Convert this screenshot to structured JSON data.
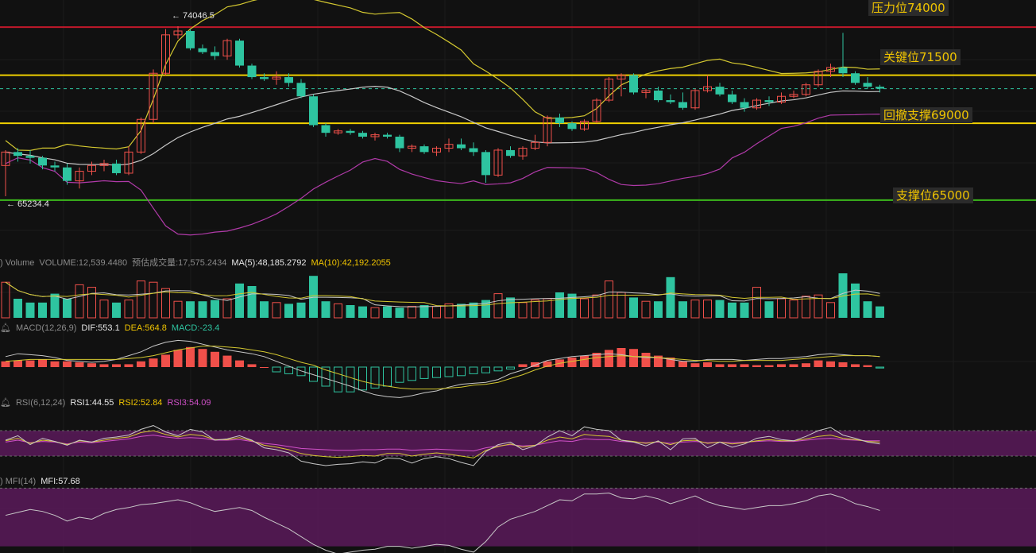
{
  "levels": [
    {
      "label": "压力位74000",
      "value": 74000,
      "color": "#c0182a"
    },
    {
      "label": "关键位71500",
      "value": 71500,
      "color": "#f0d000"
    },
    {
      "label": "回撤支撑69000",
      "value": 69000,
      "color": "#f0d000"
    },
    {
      "label": "支撑位65000",
      "value": 65000,
      "color": "#3cb81c"
    }
  ],
  "extremes": {
    "high": "← 74046.5",
    "low": "← 65234.4"
  },
  "volume_header": {
    "name": ") Volume",
    "volume": "VOLUME:12,539.4480",
    "predicted": "预估成交量:17,575.2434",
    "ma5": "MA(5):48,185.2792",
    "ma10": "MA(10):42,192.2055"
  },
  "macd_header": {
    "name": "MACD(12,26,9)",
    "dif": "DIF:553.1",
    "dea": "DEA:564.8",
    "macd": "MACD:-23.4"
  },
  "rsi_header": {
    "name": "RSI(6,12,24)",
    "rsi1": "RSI1:44.55",
    "rsi2": "RSI2:52.84",
    "rsi3": "RSI3:54.09"
  },
  "mfi_header": {
    "name": ") MFI(14)",
    "mfi": "MFI:57.68"
  },
  "colors": {
    "up": "#f0504a",
    "down": "#2ec4a0",
    "mid": "#c8c8c8",
    "boll_up": "#d4c830",
    "boll_low": "#b03aa8",
    "dif": "#c8c8c8",
    "dea": "#d4c830",
    "rsi_band": "#5a1a5a"
  },
  "chart_data": {
    "type": "candlestick",
    "y_range": [
      64000,
      75000
    ],
    "candles": [
      [
        66800,
        67600,
        65200,
        67500
      ],
      [
        67500,
        67700,
        67000,
        67300
      ],
      [
        67300,
        67600,
        66900,
        67200
      ],
      [
        67200,
        67300,
        66600,
        66800
      ],
      [
        66800,
        67000,
        66500,
        66700
      ],
      [
        66700,
        66900,
        65800,
        66000
      ],
      [
        66000,
        66700,
        65600,
        66500
      ],
      [
        66500,
        67000,
        66300,
        66800
      ],
      [
        66800,
        67100,
        66500,
        66900
      ],
      [
        66900,
        67100,
        66300,
        66400
      ],
      [
        66400,
        67800,
        66300,
        67500
      ],
      [
        67500,
        69300,
        67400,
        69200
      ],
      [
        69200,
        71800,
        69000,
        71600
      ],
      [
        71600,
        73900,
        71500,
        73600
      ],
      [
        73600,
        74046.5,
        73400,
        73800
      ],
      [
        73800,
        73900,
        72800,
        72900
      ],
      [
        72900,
        73100,
        72600,
        72700
      ],
      [
        72700,
        73000,
        72300,
        72500
      ],
      [
        72500,
        73400,
        72300,
        73300
      ],
      [
        73300,
        73400,
        71900,
        72000
      ],
      [
        72000,
        72100,
        71300,
        71400
      ],
      [
        71400,
        71600,
        71200,
        71300
      ],
      [
        71300,
        71700,
        71000,
        71400
      ],
      [
        71400,
        71600,
        70900,
        71100
      ],
      [
        71100,
        71300,
        70300,
        70400
      ],
      [
        70400,
        70500,
        68800,
        68900
      ],
      [
        68900,
        69000,
        68300,
        68500
      ],
      [
        68500,
        68700,
        68400,
        68600
      ],
      [
        68600,
        68700,
        68400,
        68500
      ],
      [
        68500,
        68600,
        68200,
        68300
      ],
      [
        68300,
        68500,
        68100,
        68400
      ],
      [
        68400,
        68500,
        68200,
        68300
      ],
      [
        68300,
        68400,
        67500,
        67700
      ],
      [
        67700,
        67900,
        67500,
        67800
      ],
      [
        67800,
        67900,
        67400,
        67500
      ],
      [
        67500,
        67800,
        67300,
        67700
      ],
      [
        67700,
        68200,
        67500,
        67900
      ],
      [
        67900,
        68200,
        67600,
        67700
      ],
      [
        67700,
        68000,
        67300,
        67500
      ],
      [
        67500,
        67600,
        65900,
        66300
      ],
      [
        66300,
        67700,
        66200,
        67600
      ],
      [
        67600,
        67800,
        67200,
        67300
      ],
      [
        67300,
        67800,
        67100,
        67700
      ],
      [
        67700,
        68400,
        67600,
        68000
      ],
      [
        68000,
        69400,
        67800,
        69300
      ],
      [
        69300,
        69500,
        68800,
        69000
      ],
      [
        69000,
        69100,
        68600,
        68700
      ],
      [
        68700,
        69200,
        68600,
        69100
      ],
      [
        69100,
        70300,
        69000,
        70200
      ],
      [
        70200,
        71400,
        70100,
        71300
      ],
      [
        71300,
        71600,
        70400,
        71500
      ],
      [
        71500,
        71600,
        70500,
        70600
      ],
      [
        70600,
        70800,
        70300,
        70700
      ],
      [
        70700,
        70900,
        70100,
        70200
      ],
      [
        70200,
        70500,
        70000,
        70100
      ],
      [
        70100,
        70600,
        69700,
        69800
      ],
      [
        69800,
        70800,
        69700,
        70700
      ],
      [
        70700,
        71500,
        70600,
        70900
      ],
      [
        70900,
        71100,
        70400,
        70500
      ],
      [
        70500,
        70700,
        70000,
        70100
      ],
      [
        70100,
        70300,
        69600,
        69800
      ],
      [
        69800,
        70300,
        69700,
        70200
      ],
      [
        70200,
        70400,
        69900,
        70100
      ],
      [
        70100,
        70600,
        70000,
        70400
      ],
      [
        70400,
        70700,
        70300,
        70500
      ],
      [
        70500,
        71100,
        70400,
        71000
      ],
      [
        71000,
        71800,
        70900,
        71700
      ],
      [
        71700,
        72100,
        71400,
        71900
      ],
      [
        71900,
        73700,
        71400,
        71600
      ],
      [
        71600,
        71700,
        71000,
        71100
      ],
      [
        71100,
        71400,
        70800,
        70900
      ],
      [
        70900,
        71000,
        70600,
        70800
      ]
    ],
    "volume": [
      2.8,
      1.5,
      1.2,
      1.2,
      1.9,
      1.5,
      2.6,
      2.4,
      1.4,
      1.2,
      1.4,
      2.9,
      2.8,
      2.3,
      1.3,
      1.3,
      1.3,
      1.4,
      1.5,
      2.7,
      2.5,
      1.3,
      1.2,
      1.1,
      1.2,
      3.3,
      1.3,
      1.1,
      1.0,
      0.9,
      0.8,
      0.9,
      0.8,
      0.9,
      1.0,
      0.9,
      1.1,
      1.1,
      1.2,
      1.4,
      1.9,
      1.6,
      1.2,
      1.4,
      1.5,
      2.0,
      1.9,
      1.5,
      1.8,
      2.9,
      2.0,
      1.6,
      1.3,
      1.3,
      3.2,
      1.3,
      1.4,
      1.4,
      1.4,
      1.2,
      1.2,
      2.4,
      1.3,
      1.5,
      1.4,
      1.7,
      1.8,
      1.2,
      3.5,
      2.7,
      1.3,
      0.9
    ],
    "macd": [
      0.6,
      0.7,
      0.7,
      0.8,
      0.6,
      0.6,
      0.5,
      0.4,
      0.3,
      0.3,
      0.3,
      0.6,
      0.9,
      1.3,
      1.8,
      2.1,
      1.9,
      1.6,
      1.2,
      0.7,
      0.3,
      0,
      -0.5,
      -0.7,
      -0.9,
      -1.5,
      -2.0,
      -2.6,
      -2.6,
      -2.4,
      -2.2,
      -2.0,
      -1.6,
      -1.4,
      -1.2,
      -1.1,
      -1.0,
      -0.9,
      -0.7,
      -0.6,
      -0.4,
      -0.2,
      0.3,
      0.5,
      0.6,
      0.8,
      1.0,
      1.2,
      1.5,
      1.8,
      2.0,
      1.9,
      1.5,
      1.2,
      1.0,
      0.6,
      0.4,
      0.5,
      0.3,
      0.3,
      0.3,
      0.2,
      0.2,
      0.3,
      0.3,
      0.4,
      0.7,
      0.6,
      0.5,
      0.3,
      0.2,
      -0.1
    ],
    "dif": [
      1.1,
      1.4,
      1.3,
      1.2,
      1.0,
      0.7,
      0.6,
      0.5,
      0.6,
      0.8,
      1.2,
      1.6,
      2.2,
      2.6,
      2.8,
      2.7,
      2.4,
      2.1,
      1.8,
      1.6,
      1.4,
      1.1,
      0.6,
      0.1,
      -0.4,
      -0.8,
      -1.2,
      -1.6,
      -2.0,
      -2.5,
      -2.9,
      -3.1,
      -3.2,
      -3.0,
      -2.7,
      -2.5,
      -2.1,
      -1.8,
      -1.7,
      -1.6,
      -1.3,
      -0.7,
      -0.3,
      0.2,
      0.7,
      0.9,
      1.1,
      1.2,
      1.3,
      1.4,
      1.3,
      1.1,
      1.0,
      1.0,
      0.8,
      0.6,
      0.6,
      0.8,
      0.8,
      0.8,
      0.7,
      0.8,
      0.9,
      0.9,
      1.0,
      1.1,
      1.3,
      1.4,
      1.3,
      1.2,
      1.2,
      1.1
    ],
    "dea": [
      0.6,
      0.7,
      0.8,
      0.8,
      0.8,
      0.8,
      0.8,
      0.8,
      0.8,
      0.8,
      0.9,
      1.0,
      1.2,
      1.5,
      1.8,
      2.0,
      2.2,
      2.2,
      2.1,
      2.0,
      1.8,
      1.6,
      1.3,
      0.9,
      0.5,
      0.2,
      -0.3,
      -0.7,
      -1.1,
      -1.5,
      -1.8,
      -2.0,
      -2.2,
      -2.3,
      -2.3,
      -2.3,
      -2.2,
      -2.1,
      -1.9,
      -1.8,
      -1.6,
      -1.2,
      -0.8,
      -0.3,
      0.1,
      0.4,
      0.6,
      0.8,
      1.0,
      1.1,
      1.2,
      1.1,
      1.1,
      1.0,
      0.9,
      0.8,
      0.7,
      0.7,
      0.6,
      0.6,
      0.7,
      0.7,
      0.7,
      0.7,
      0.8,
      0.9,
      1.0,
      1.1,
      1.2,
      1.2,
      1.2,
      1.1
    ],
    "rsi1": [
      55,
      62,
      48,
      58,
      53,
      47,
      55,
      52,
      58,
      60,
      63,
      72,
      78,
      68,
      62,
      72,
      68,
      55,
      57,
      62,
      55,
      43,
      40,
      35,
      22,
      18,
      15,
      17,
      18,
      21,
      19,
      27,
      26,
      19,
      26,
      29,
      26,
      20,
      15,
      37,
      48,
      52,
      40,
      46,
      60,
      70,
      62,
      76,
      72,
      70,
      55,
      52,
      46,
      54,
      40,
      57,
      58,
      43,
      52,
      44,
      49,
      58,
      61,
      56,
      54,
      61,
      70,
      75,
      63,
      58,
      52,
      49
    ],
    "rsi2": [
      54,
      58,
      50,
      55,
      53,
      48,
      54,
      52,
      55,
      58,
      60,
      67,
      70,
      64,
      60,
      64,
      62,
      56,
      56,
      59,
      54,
      47,
      44,
      40,
      34,
      31,
      29,
      28,
      29,
      31,
      30,
      34,
      34,
      30,
      33,
      35,
      33,
      30,
      27,
      39,
      45,
      49,
      44,
      47,
      55,
      60,
      57,
      64,
      62,
      61,
      55,
      53,
      50,
      53,
      48,
      54,
      55,
      50,
      52,
      49,
      51,
      54,
      56,
      54,
      54,
      57,
      61,
      63,
      58,
      56,
      53,
      52
    ],
    "rsi3": [
      52,
      55,
      51,
      53,
      52,
      49,
      52,
      51,
      53,
      55,
      57,
      61,
      63,
      60,
      58,
      59,
      58,
      55,
      55,
      56,
      53,
      50,
      48,
      45,
      42,
      41,
      40,
      39,
      39,
      40,
      40,
      41,
      41,
      39,
      40,
      41,
      40,
      39,
      38,
      43,
      46,
      48,
      46,
      47,
      51,
      54,
      53,
      57,
      56,
      56,
      53,
      52,
      51,
      52,
      50,
      52,
      53,
      51,
      52,
      51,
      52,
      53,
      54,
      53,
      53,
      55,
      57,
      58,
      56,
      55,
      54,
      54
    ],
    "mfi": [
      52,
      55,
      58,
      56,
      52,
      46,
      50,
      48,
      54,
      58,
      60,
      63,
      64,
      66,
      68,
      65,
      60,
      56,
      58,
      60,
      57,
      50,
      44,
      38,
      30,
      22,
      16,
      12,
      14,
      16,
      17,
      20,
      20,
      18,
      20,
      22,
      21,
      17,
      14,
      25,
      40,
      48,
      52,
      56,
      62,
      68,
      67,
      74,
      74,
      75,
      70,
      69,
      72,
      69,
      64,
      68,
      72,
      66,
      62,
      60,
      58,
      60,
      62,
      62,
      64,
      67,
      72,
      74,
      70,
      64,
      61,
      57
    ]
  }
}
